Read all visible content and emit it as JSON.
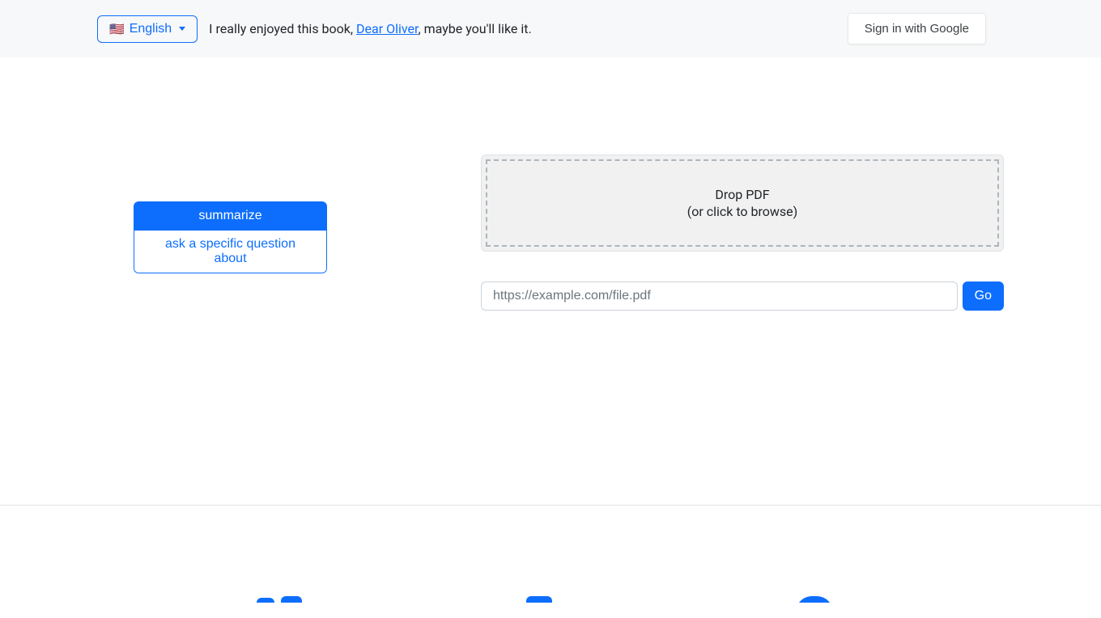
{
  "header": {
    "language": {
      "flag": "🇺🇸",
      "label": "English"
    },
    "quote": {
      "prefix": "I really enjoyed this book, ",
      "link_text": "Dear Oliver",
      "suffix": ", maybe you'll like it."
    },
    "signin_label": "Sign in with Google"
  },
  "actions": {
    "summarize_label": "summarize",
    "ask_label": "ask a specific question about"
  },
  "upload": {
    "drop_title": "Drop PDF",
    "drop_subtitle": "(or click to browse)",
    "url_placeholder": "https://example.com/file.pdf",
    "url_value": "",
    "go_label": "Go"
  }
}
